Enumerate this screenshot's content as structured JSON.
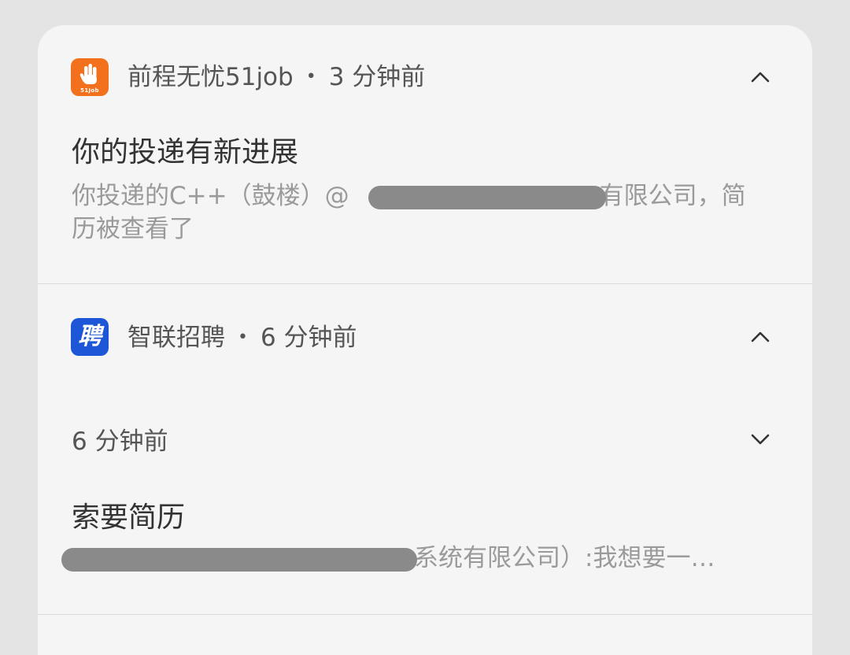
{
  "notifications": [
    {
      "app_name": "前程无忧51job",
      "icon": "51job-hand-icon",
      "icon_text": "51Job",
      "time": "3 分钟前",
      "title": "你的投递有新进展",
      "body_before": "你投递的C++（鼓楼）@",
      "body_after": "有限公司，简",
      "body_line2": "历被查看了",
      "expanded": true
    },
    {
      "app_name": "智联招聘",
      "icon": "zhilian-pin-icon",
      "icon_glyph": "聘",
      "time": "6 分钟前",
      "expanded": true,
      "sub": {
        "time": "6 分钟前",
        "title": "索要简历",
        "body_after": "系统有限公司）:我想要一…"
      }
    }
  ],
  "colors": {
    "panel": "#f5f5f5",
    "background": "#e4e4e4",
    "job51_orange": "#f3701c",
    "zhilian_blue": "#1e56d8"
  }
}
